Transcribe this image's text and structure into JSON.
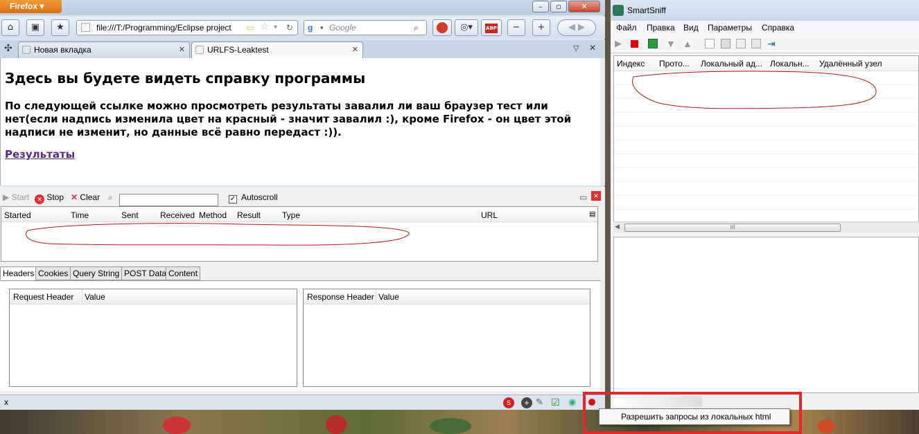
{
  "firefox": {
    "menu_button": "Firefox",
    "url": "file:///T:/Programming/Eclipse project",
    "search_placeholder": "Google",
    "tabs": [
      {
        "label": "Новая вкладка"
      },
      {
        "label": "URLFS-Leaktest"
      }
    ],
    "page": {
      "heading": "Здесь вы будете видеть справку программы",
      "paragraph": "По следующей ссылке можно просмотреть результаты завалил ли ваш браузер тест или нет(если надпись изменила цвет на красный - значит завалил :), кроме Firefox - он цвет этой надписи не изменит, но данные всё равно передаст :)).",
      "link": "Результаты"
    }
  },
  "httpfox": {
    "toolbar": {
      "start": "Start",
      "stop": "Stop",
      "clear": "Clear",
      "autoscroll": "Autoscroll"
    },
    "columns": [
      "Started",
      "Time",
      "Sent",
      "Received",
      "Method",
      "Result",
      "Type",
      "URL"
    ],
    "tabs": [
      "Headers",
      "Cookies",
      "Query String",
      "POST Data",
      "Content"
    ],
    "request_table": {
      "col1": "Request Header",
      "col2": "Value"
    },
    "response_table": {
      "col1": "Response Header",
      "col2": "Value"
    },
    "status_close": "x"
  },
  "smartsniff": {
    "title": "SmartSniff",
    "menu": [
      "Файл",
      "Правка",
      "Вид",
      "Параметры",
      "Справка"
    ],
    "columns": [
      "Индекс",
      "Прото...",
      "Локальный ад...",
      "Локальн...",
      "Удалённый узел"
    ],
    "hscroll_grip": "III"
  },
  "popup": {
    "label": "Разрешить запросы из локальных html"
  },
  "colors": {
    "highlight": "#e2262c",
    "firefox_orange": "#e57f1e",
    "link": "#5b2a86",
    "scribble": "#b01818"
  }
}
